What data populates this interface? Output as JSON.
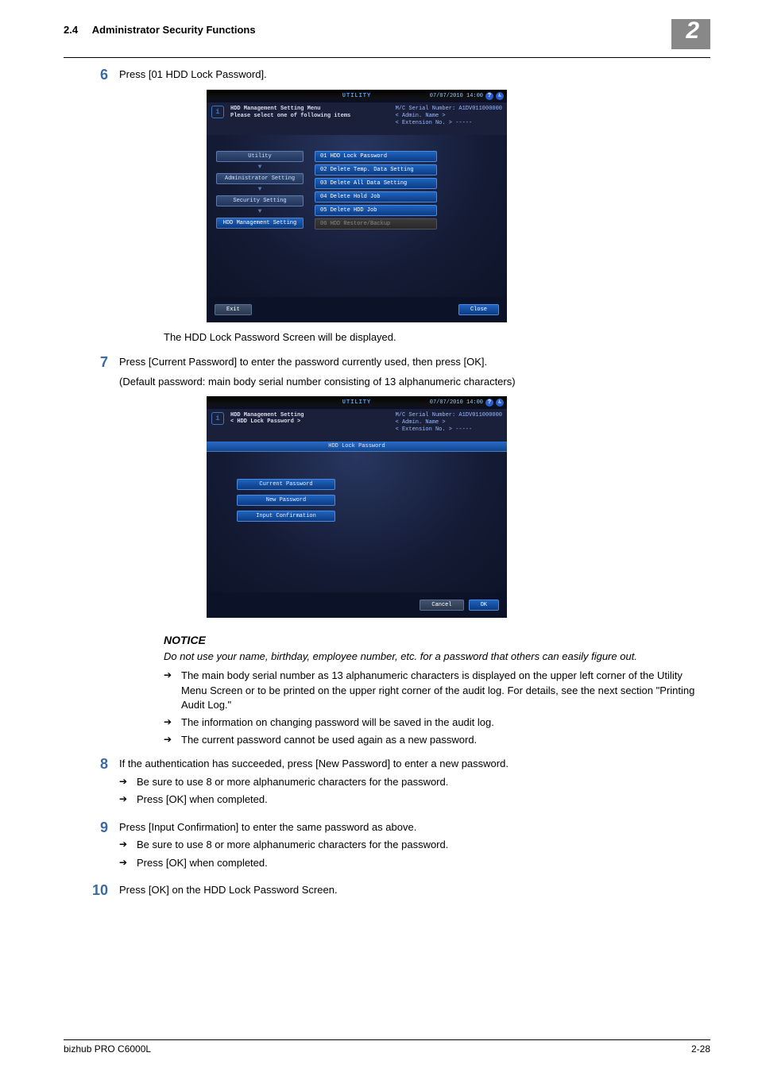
{
  "header": {
    "section_num": "2.4",
    "section_title": "Administrator Security Functions",
    "chapter": "2"
  },
  "steps": {
    "s6": {
      "num": "6",
      "text": "Press [01 HDD Lock Password]."
    },
    "after6": "The HDD Lock Password Screen will be displayed.",
    "s7": {
      "num": "7",
      "line1": "Press [Current Password] to enter the password currently used, then press [OK].",
      "line2": "(Default password: main body serial number consisting of 13 alphanumeric characters)"
    },
    "notice": {
      "title": "NOTICE",
      "text": "Do not use your name, birthday, employee number, etc. for a password that others can easily figure out.",
      "b1": "The main body serial number as 13 alphanumeric characters is displayed on the upper left corner of the Utility Menu Screen or to be printed on the upper right corner of the audit log. For details, see the next section \"Printing Audit Log.\"",
      "b2": "The information on changing password will be saved in the audit log.",
      "b3": "The current password cannot be used again as a new password."
    },
    "s8": {
      "num": "8",
      "text": "If the authentication has succeeded, press [New Password] to enter a new password.",
      "b1": "Be sure to use 8 or more alphanumeric characters for the password.",
      "b2": "Press [OK] when completed."
    },
    "s9": {
      "num": "9",
      "text": "Press [Input Confirmation] to enter the same password as above.",
      "b1": "Be sure to use 8 or more alphanumeric characters for the password.",
      "b2": "Press [OK] when completed."
    },
    "s10": {
      "num": "10",
      "text": "Press [OK] on the HDD Lock Password Screen."
    }
  },
  "panel1": {
    "tab": "UTILITY",
    "timestamp": "07/07/2010 14:00",
    "title1": "HDD Management Setting Menu",
    "title2": "Please select one of following items",
    "meta1": "M/C Serial Number: A1DV011000000",
    "meta2": "< Admin. Name >",
    "meta3": "< Extension No. >  -----",
    "crumbs": {
      "c1": "Utility",
      "c2": "Administrator Setting",
      "c3": "Security Setting",
      "c4": "HDD Management Setting"
    },
    "menu": {
      "m1": "01 HDD Lock Password",
      "m2": "02 Delete Temp. Data Setting",
      "m3": "03 Delete All Data Setting",
      "m4": "04 Delete Hold Job",
      "m5": "05 Delete HDD Job",
      "m6": "06 HDD Restore/Backup"
    },
    "btn_exit": "Exit",
    "btn_close": "Close"
  },
  "panel2": {
    "tab": "UTILITY",
    "timestamp": "07/07/2010 14:00",
    "title1": "HDD Management Setting",
    "title2": "< HDD Lock Password >",
    "meta1": "M/C Serial Number: A1DV011000000",
    "meta2": "< Admin. Name >",
    "meta3": "< Extension No. >  -----",
    "section": "HDD Lock Password",
    "f1": "Current Password",
    "f2": "New Password",
    "f3": "Input Confirmation",
    "btn_cancel": "Cancel",
    "btn_ok": "OK"
  },
  "footer": {
    "left": "bizhub PRO C6000L",
    "right": "2-28"
  }
}
